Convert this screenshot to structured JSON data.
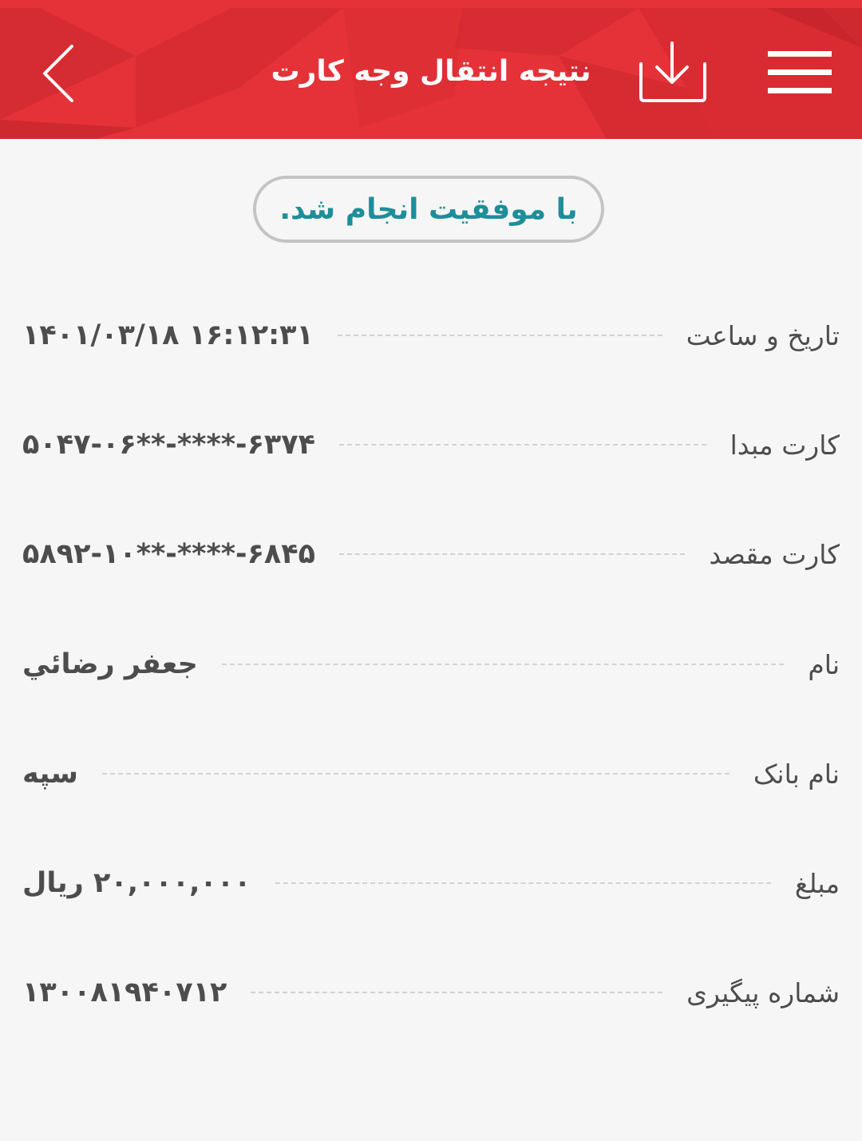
{
  "header": {
    "title": "نتیجه انتقال وجه کارت",
    "color": "#e53238",
    "back_icon": "chevron-left-icon",
    "download_icon": "download-icon",
    "menu_icon": "hamburger-menu-icon"
  },
  "status": {
    "text": "با موفقیت انجام شد.",
    "color": "#1d8e9a"
  },
  "details": {
    "datetime": {
      "label": "تاریخ و ساعت",
      "value": "۱۴۰۱/۰۳/۱۸ ۱۶:۱۲:۳۱"
    },
    "source_card": {
      "label": "کارت مبدا",
      "value": "۵۰۴۷-۰۶**-****-۶۳۷۴"
    },
    "dest_card": {
      "label": "کارت مقصد",
      "value": "۵۸۹۲-۱۰**-****-۶۸۴۵"
    },
    "name": {
      "label": "نام",
      "value": "جعفر رضائي"
    },
    "bank_name": {
      "label": "نام بانک",
      "value": "سپه"
    },
    "amount": {
      "label": "مبلغ",
      "value": "۲۰,۰۰۰,۰۰۰ ریال"
    },
    "tracking": {
      "label": "شماره پیگیری",
      "value": "۱۳۰۰۸۱۹۴۰۷۱۲"
    }
  }
}
